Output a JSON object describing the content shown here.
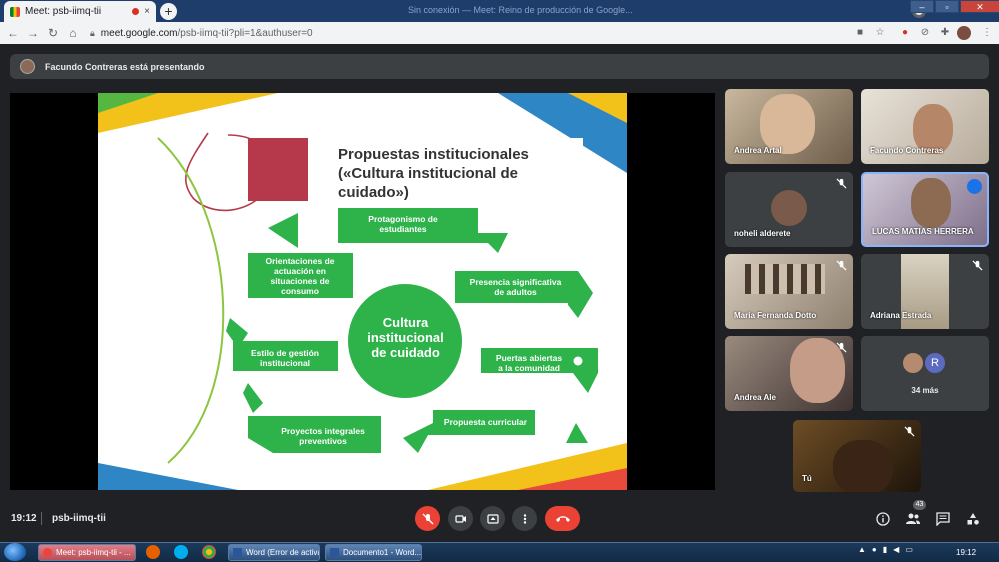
{
  "browser": {
    "tab_title": "Meet: psb-iimq-tii",
    "tab_close": "×",
    "new_tab": "+",
    "window_title": "Sin conexión — Meet: Reino de producción de Google...",
    "url_host": "meet.google.com",
    "url_path": "/psb-iimq-tii?pli=1&authuser=0"
  },
  "meet": {
    "presenting_text": "Facundo Contreras está presentando",
    "clock": "19:12",
    "meeting_code": "psb-iimq-tii",
    "participant_count": "43",
    "more_label": "34 más",
    "more_avatar_letter": "R",
    "colors": {
      "end_call": "#ea4335",
      "active_speaker": "#8ab4f8",
      "background": "#202124"
    }
  },
  "slide": {
    "title": "Propuestas institucionales («Cultura institucional de cuidado»)",
    "title_lines": [
      "Propuestas institucionales",
      "(«Cultura institucional de",
      "cuidado»)"
    ],
    "center": [
      "Cultura",
      "institucional",
      "de cuidado"
    ],
    "items": [
      "Protagonismo de estudiantes",
      "Presencia significativa de adultos",
      "Puertas abiertas a la comunidad",
      "Propuesta curricular",
      "Proyectos integrales preventivos",
      "Estilo de gestión institucional",
      "Orientaciones de actuación en situaciones de consumo"
    ],
    "item_lines": [
      [
        "Protagonismo de",
        "estudiantes"
      ],
      [
        "Presencia significativa",
        "de adultos"
      ],
      [
        "Puertas abiertas",
        "a la comunidad"
      ],
      [
        "Propuesta curricular"
      ],
      [
        "Proyectos integrales",
        "preventivos"
      ],
      [
        "Estilo de gestión",
        "institucional"
      ],
      [
        "Orientaciones de",
        "actuación en",
        "situaciones de",
        "consumo"
      ]
    ],
    "colors": {
      "green": "#2db34a",
      "title_bar": "#b5394b",
      "yellow": "#f2c21b",
      "blue": "#2f86c4"
    }
  },
  "participants": [
    {
      "name": "Andrea Artal",
      "muted": false
    },
    {
      "name": "Facundo Contreras",
      "muted": false
    },
    {
      "name": "noheli alderete",
      "muted": true
    },
    {
      "name": "LUCAS MATIAS HERRERA",
      "muted": false,
      "speaking": true
    },
    {
      "name": "Maria Fernanda Dotto",
      "muted": true
    },
    {
      "name": "Adriana Estrada",
      "muted": true
    },
    {
      "name": "Andrea Ale",
      "muted": true
    },
    {
      "name": "Tú",
      "muted": true
    }
  ],
  "taskbar": {
    "items": [
      "Meet: psb-iimq-tii - ...",
      "Word (Error de activa...",
      "Documento1 - Word..."
    ],
    "clock": "19:12"
  }
}
